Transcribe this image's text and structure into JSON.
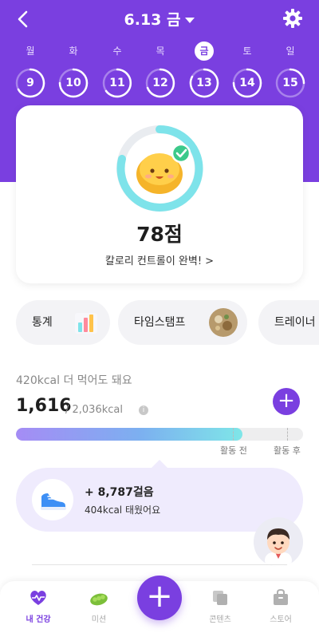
{
  "header": {
    "date_label": "6.13 금",
    "colors": {
      "accent": "#7a3fe0",
      "ring": "#ffffff"
    }
  },
  "week": [
    {
      "dow": "월",
      "day": "9",
      "active": false
    },
    {
      "dow": "화",
      "day": "10",
      "active": false
    },
    {
      "dow": "수",
      "day": "11",
      "active": false
    },
    {
      "dow": "목",
      "day": "12",
      "active": false
    },
    {
      "dow": "금",
      "day": "13",
      "active": true
    },
    {
      "dow": "토",
      "day": "14",
      "active": false
    },
    {
      "dow": "일",
      "day": "15",
      "active": false
    }
  ],
  "score_card": {
    "score": "78점",
    "message": "칼로리 컨트롤이 완벽! >",
    "ring_color": "#7ee3ea"
  },
  "chips": [
    {
      "label": "통계",
      "icon": "chart-icon"
    },
    {
      "label": "타임스탬프",
      "icon": "food-photo-icon"
    },
    {
      "label": "트레이너",
      "icon": "trainer-icon"
    }
  ],
  "calories": {
    "remaining": "420kcal 더 먹어도 돼요",
    "current": "1,616",
    "goal": "/ 2,036kcal",
    "progress": 0.79,
    "marker_before": "활동 전",
    "marker_after": "활동 후"
  },
  "steps": {
    "count": "+ 8,787걸음",
    "burned": "404kcal 태웠어요"
  },
  "tabs": {
    "health": "내 건강",
    "mission": "미션",
    "contents": "콘텐츠",
    "store": "스토어"
  }
}
